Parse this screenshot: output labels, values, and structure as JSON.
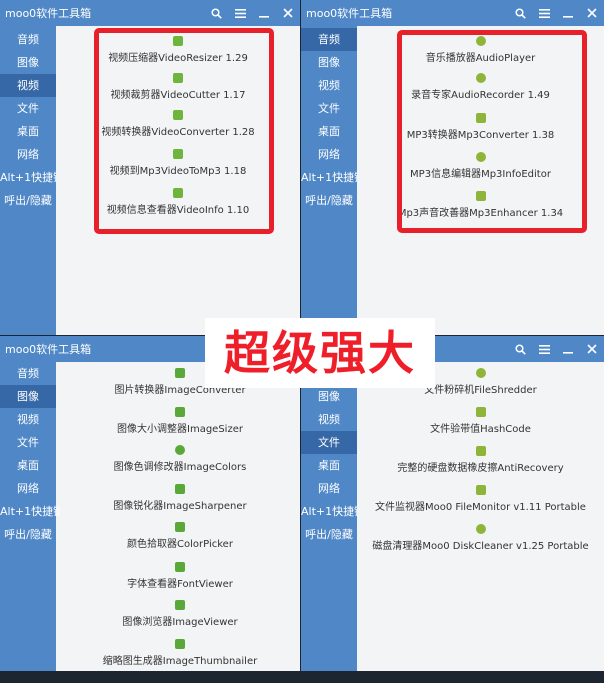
{
  "overlay_text": "超级强大",
  "colors": {
    "titlebar": "#4f87c7",
    "sidebar_active": "#3668a7",
    "highlight_box": "#e8202a",
    "overlay_text": "#ef1f2a"
  },
  "windows": [
    {
      "title": "moo0软件工具箱",
      "sidebar": [
        "音频",
        "图像",
        "视频",
        "文件",
        "桌面",
        "网络",
        "Alt+1快捷键",
        "呼出/隐藏"
      ],
      "active_index": 2,
      "apps": [
        {
          "icon": "video-resizer-icon",
          "label": "视频压缩器VideoResizer 1.29"
        },
        {
          "icon": "video-cutter-icon",
          "label": "视频裁剪器VideoCutter 1.17"
        },
        {
          "icon": "video-converter-icon",
          "label": "视频转换器VideoConverter 1.28"
        },
        {
          "icon": "video-to-mp3-icon",
          "label": "视频到Mp3VideoToMp3 1.18"
        },
        {
          "icon": "video-info-icon",
          "label": "视频信息查看器VideoInfo 1.10"
        }
      ]
    },
    {
      "title": "moo0软件工具箱",
      "sidebar": [
        "音频",
        "图像",
        "视频",
        "文件",
        "桌面",
        "网络",
        "Alt+1快捷键",
        "呼出/隐藏"
      ],
      "active_index": 0,
      "apps": [
        {
          "icon": "audio-player-icon",
          "label": "音乐播放器AudioPlayer"
        },
        {
          "icon": "audio-recorder-icon",
          "label": "录音专家AudioRecorder 1.49"
        },
        {
          "icon": "mp3-converter-icon",
          "label": "MP3转换器Mp3Converter 1.38"
        },
        {
          "icon": "mp3-info-editor-icon",
          "label": "MP3信息编辑器Mp3InfoEditor"
        },
        {
          "icon": "mp3-enhancer-icon",
          "label": "Mp3声音改善器Mp3Enhancer 1.34"
        }
      ]
    },
    {
      "title": "moo0软件工具箱",
      "sidebar": [
        "音频",
        "图像",
        "视频",
        "文件",
        "桌面",
        "网络",
        "Alt+1快捷键",
        "呼出/隐藏"
      ],
      "active_index": 1,
      "apps": [
        {
          "icon": "image-converter-icon",
          "label": "图片转换器ImageConverter"
        },
        {
          "icon": "image-sizer-icon",
          "label": "图像大小调整器ImageSizer"
        },
        {
          "icon": "image-colors-icon",
          "label": "图像色调修改器ImageColors"
        },
        {
          "icon": "image-sharpener-icon",
          "label": "图像锐化器ImageSharpener"
        },
        {
          "icon": "color-picker-icon",
          "label": "颜色拾取器ColorPicker"
        },
        {
          "icon": "font-viewer-icon",
          "label": "字体查看器FontViewer"
        },
        {
          "icon": "image-viewer-icon",
          "label": "图像浏览器ImageViewer"
        },
        {
          "icon": "image-thumbnailer-icon",
          "label": "缩略图生成器ImageThumbnailer"
        }
      ]
    },
    {
      "title": "",
      "sidebar": [
        "音频",
        "图像",
        "视频",
        "文件",
        "桌面",
        "网络",
        "Alt+1快捷键",
        "呼出/隐藏"
      ],
      "active_index": 3,
      "apps": [
        {
          "icon": "file-shredder-icon",
          "label": "文件粉碎机FileShredder"
        },
        {
          "icon": "hash-code-icon",
          "label": "文件验带值HashCode"
        },
        {
          "icon": "anti-recovery-icon",
          "label": "完整的硬盘数据橡皮擦AntiRecovery"
        },
        {
          "icon": "file-monitor-icon",
          "label": "文件监视器Moo0 FileMonitor v1.11 Portable"
        },
        {
          "icon": "disk-cleaner-icon",
          "label": "磁盘清理器Moo0 DiskCleaner v1.25 Portable"
        }
      ]
    }
  ]
}
